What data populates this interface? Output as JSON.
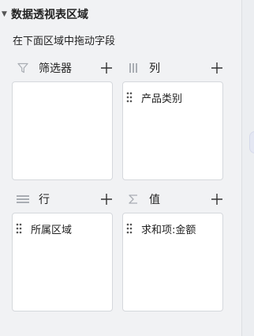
{
  "panel": {
    "title": "数据透视表区域",
    "subtitle": "在下面区域中拖动字段"
  },
  "areas": {
    "filter": {
      "label": "筛选器",
      "icon": "filter-icon",
      "fields": []
    },
    "columns": {
      "label": "列",
      "icon": "columns-icon",
      "fields": [
        "产品类别"
      ]
    },
    "rows": {
      "label": "行",
      "icon": "rows-icon",
      "fields": [
        "所属区域"
      ]
    },
    "values": {
      "label": "值",
      "icon": "sigma-icon",
      "fields": [
        "求和项:金额"
      ]
    }
  },
  "colors": {
    "background": "#f1f2f4",
    "box": "#ffffff",
    "border": "#d5d8dc",
    "icon": "#a9adb3",
    "text": "#222222"
  }
}
